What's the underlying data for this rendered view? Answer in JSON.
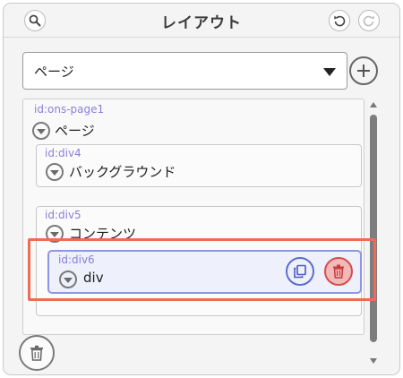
{
  "header": {
    "title": "レイアウト",
    "search_icon": "search-icon",
    "undo_icon": "undo-icon",
    "redo_icon": "redo-icon"
  },
  "page_select": {
    "value": "ページ",
    "add_icon": "plus-icon"
  },
  "tree": {
    "root": {
      "id_label": "id:ons-page1",
      "name": "ページ"
    },
    "background": {
      "id_label": "id:div4",
      "name": "バックグラウンド"
    },
    "content": {
      "id_label": "id:div5",
      "name": "コンテンツ"
    },
    "selected": {
      "id_label": "id:div6",
      "name": "div",
      "copy_icon": "copy-icon",
      "delete_icon": "trash-icon"
    }
  },
  "footer": {
    "delete_icon": "trash-icon"
  },
  "colors": {
    "id_label": "#8a7fd9",
    "selected_bg": "#eef0fb",
    "selected_border": "#8d95e6",
    "delete_red": "#d84c4c",
    "highlight": "#f06b55"
  }
}
